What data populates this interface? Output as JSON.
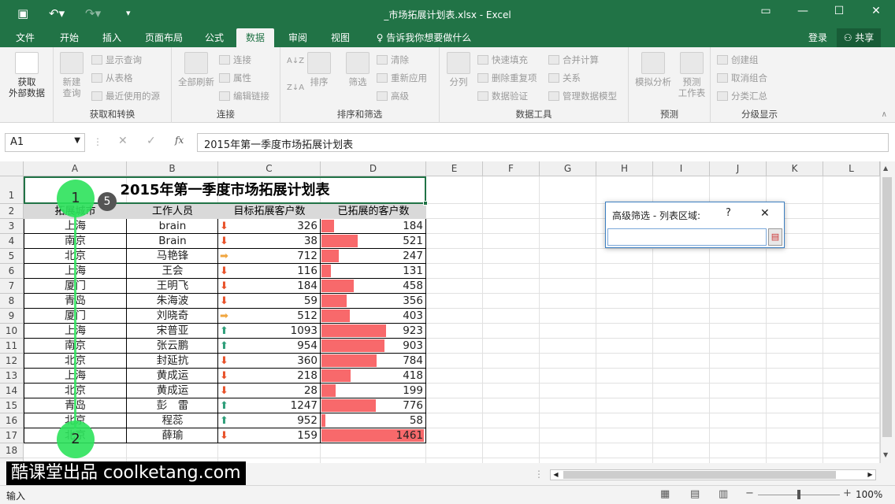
{
  "window": {
    "title": "_市场拓展计划表.xlsx - Excel"
  },
  "tabs": [
    "文件",
    "开始",
    "插入",
    "页面布局",
    "公式",
    "数据",
    "审阅",
    "视图"
  ],
  "tell_me": "告诉我你想要做什么",
  "account": {
    "login": "登录",
    "share": "共享"
  },
  "ribbon": {
    "get_external": [
      "获取",
      "外部数据"
    ],
    "new_query": [
      "新建",
      "查询"
    ],
    "show_query": "显示查询",
    "from_table": "从表格",
    "recent_sources": "最近使用的源",
    "group_get": "获取和转换",
    "refresh_all": "全部刷新",
    "connections": "连接",
    "properties": "属性",
    "edit_links": "编辑链接",
    "group_conn": "连接",
    "sort": "排序",
    "filter": "筛选",
    "clear": "清除",
    "reapply": "重新应用",
    "advanced": "高级",
    "group_sort": "排序和筛选",
    "text_to_col": "分列",
    "flash_fill": "快速填充",
    "remove_dup": "删除重复项",
    "validation": "数据验证",
    "consolidate": "合并计算",
    "relations": "关系",
    "data_model": "管理数据模型",
    "group_tools": "数据工具",
    "whatif": "模拟分析",
    "forecast": [
      "预测",
      "工作表"
    ],
    "group_forecast": "预测",
    "group_btn": "创建组",
    "ungroup": "取消组合",
    "subtotal": "分类汇总",
    "group_outline": "分级显示"
  },
  "formula_bar": {
    "namebox": "A1",
    "content": "2015年第一季度市场拓展计划表"
  },
  "sheet": {
    "columns": [
      "A",
      "B",
      "C",
      "D",
      "E",
      "F",
      "G",
      "H",
      "I",
      "J",
      "K",
      "L"
    ],
    "title": "2015年第一季度市场拓展计划表",
    "headers": [
      "拓展城市",
      "工作人员",
      "目标拓展客户数",
      "已拓展的客户数"
    ],
    "rows": [
      [
        "上海",
        "brain",
        "326",
        "184"
      ],
      [
        "南京",
        "Brain",
        "38",
        "521"
      ],
      [
        "北京",
        "马艳锋",
        "712",
        "247"
      ],
      [
        "上海",
        "王会",
        "116",
        "131"
      ],
      [
        "厦门",
        "王明飞",
        "184",
        "458"
      ],
      [
        "青岛",
        "朱海波",
        "59",
        "356"
      ],
      [
        "厦门",
        "刘晓奇",
        "512",
        "403"
      ],
      [
        "上海",
        "宋普亚",
        "1093",
        "923"
      ],
      [
        "南京",
        "张云鹏",
        "954",
        "903"
      ],
      [
        "北京",
        "封延抗",
        "360",
        "784"
      ],
      [
        "上海",
        "黄成运",
        "218",
        "418"
      ],
      [
        "北京",
        "黄成运",
        "28",
        "199"
      ],
      [
        "青岛",
        "彭　雷",
        "1247",
        "776"
      ],
      [
        "北京",
        "程蕊",
        "952",
        "58"
      ],
      [
        "北京",
        "薛瑜",
        "159",
        "1461"
      ]
    ],
    "arrow_icons": [
      "down",
      "down",
      "right",
      "down",
      "down",
      "down",
      "right",
      "up",
      "up",
      "down",
      "down",
      "down",
      "up",
      "up",
      "down"
    ]
  },
  "dialog": {
    "title": "高级筛选 - 列表区域:",
    "help": "?",
    "close": "✕"
  },
  "annotations": {
    "start": "1",
    "end": "2",
    "count": "5"
  },
  "watermark": "酷课堂出品 coolketang.com",
  "status": {
    "mode": "输入",
    "zoom": "100%"
  }
}
